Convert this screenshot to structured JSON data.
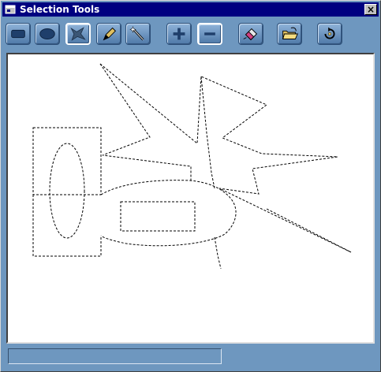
{
  "window": {
    "title": "Selection Tools",
    "close_glyph": "×",
    "app_icon": "window-app-icon"
  },
  "toolbar": {
    "tools": [
      {
        "name": "rectangle-select-tool",
        "icon": "rectangle-icon",
        "selected": false
      },
      {
        "name": "ellipse-select-tool",
        "icon": "ellipse-icon",
        "selected": false
      },
      {
        "name": "polygon-select-tool",
        "icon": "polygon-lasso-icon",
        "selected": true
      },
      {
        "name": "freehand-select-tool",
        "icon": "pen-icon",
        "selected": false
      },
      {
        "name": "magic-wand-tool",
        "icon": "magic-wand-icon",
        "selected": false
      },
      {
        "name": "add-selection-mode",
        "icon": "plus-icon",
        "selected": false
      },
      {
        "name": "subtract-selection-mode",
        "icon": "minus-icon",
        "selected": true
      },
      {
        "name": "clear-selection-tool",
        "icon": "eraser-icon",
        "selected": false
      },
      {
        "name": "open-file-tool",
        "icon": "folder-open-icon",
        "selected": false
      },
      {
        "name": "rotate-tool",
        "icon": "rotate-icon",
        "selected": false
      }
    ]
  },
  "status": {
    "text": ""
  },
  "colors": {
    "window_bg": "#6e97bf",
    "title_bar": "#000080",
    "canvas_bg": "#ffffff",
    "selection_stroke": "#000000"
  }
}
